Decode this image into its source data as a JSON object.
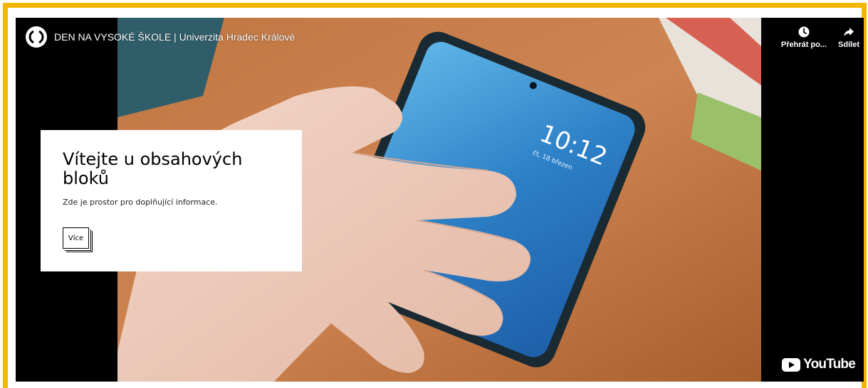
{
  "video": {
    "title": "DEN NA VYSOKÉ ŠKOLE | Univerzita Hradec Králové",
    "channel_avatar_icon": "university-logo-icon",
    "actions": [
      {
        "label": "Přehrát po...",
        "icon": "clock-icon"
      },
      {
        "label": "Sdílet",
        "icon": "share-arrow-icon"
      }
    ],
    "brand": {
      "wordmark": "YouTube",
      "icon": "youtube-play-icon"
    },
    "phone_clock": "10:12",
    "phone_date": "čt, 18 březen"
  },
  "card": {
    "heading": "Vítejte u obsahových bloků",
    "text": "Zde je prostor pro doplňující informace.",
    "button_label": "Více"
  },
  "colors": {
    "frame": "#f2b705",
    "player_bg": "#000000",
    "card_bg": "#ffffff",
    "youtube_red": "#ff0000"
  }
}
